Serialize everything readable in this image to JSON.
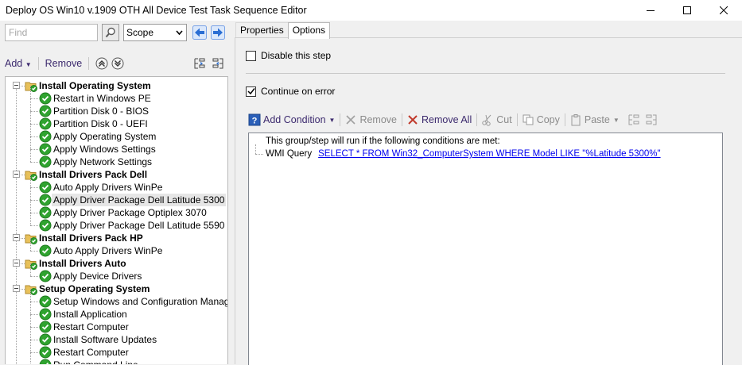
{
  "window": {
    "title": "Deploy OS Win10 v.1909 OTH All Device Test Task Sequence Editor",
    "controls": [
      "minimize-icon",
      "maximize-icon",
      "close-icon"
    ]
  },
  "left_toolbar": {
    "find_placeholder": "Find",
    "search_icon": "magnifier-icon",
    "scope_value": "Scope",
    "back_icon": "arrow-left-icon",
    "forward_icon": "arrow-right-icon",
    "add_label": "Add",
    "remove_label": "Remove",
    "move_up_icon": "move-up-icon",
    "move_down_icon": "move-down-icon",
    "group_icons": [
      "indent-icon",
      "outdent-icon"
    ]
  },
  "tree": [
    {
      "label": "Install Operating System",
      "type": "group"
    },
    {
      "label": "Restart in Windows PE",
      "type": "step"
    },
    {
      "label": "Partition Disk 0 - BIOS",
      "type": "step"
    },
    {
      "label": "Partition Disk 0 - UEFI",
      "type": "step"
    },
    {
      "label": "Apply Operating System",
      "type": "step"
    },
    {
      "label": "Apply Windows Settings",
      "type": "step"
    },
    {
      "label": "Apply Network Settings",
      "type": "step"
    },
    {
      "label": "Install Drivers Pack Dell",
      "type": "group"
    },
    {
      "label": "Auto Apply Drivers WinPe",
      "type": "step"
    },
    {
      "label": "Apply Driver Package Dell Latitude 5300",
      "type": "step",
      "selected": true
    },
    {
      "label": "Apply Driver Package Optiplex 3070",
      "type": "step"
    },
    {
      "label": "Apply Driver Package Dell Latitude 5590",
      "type": "step"
    },
    {
      "label": "Install Drivers Pack HP",
      "type": "group"
    },
    {
      "label": "Auto Apply Drivers WinPe",
      "type": "step"
    },
    {
      "label": "Install Drivers Auto",
      "type": "group"
    },
    {
      "label": "Apply Device Drivers",
      "type": "step"
    },
    {
      "label": "Setup Operating System",
      "type": "group"
    },
    {
      "label": "Setup Windows and Configuration Manager",
      "type": "step"
    },
    {
      "label": "Install Application",
      "type": "step"
    },
    {
      "label": "Restart Computer",
      "type": "step"
    },
    {
      "label": "Install Software Updates",
      "type": "step"
    },
    {
      "label": "Restart Computer",
      "type": "step"
    },
    {
      "label": "Run Command Line",
      "type": "step"
    }
  ],
  "tabs": [
    {
      "label": "Properties",
      "active": false
    },
    {
      "label": "Options",
      "active": true
    }
  ],
  "options": {
    "disable_step": {
      "label": "Disable this step",
      "checked": false
    },
    "continue_on_error": {
      "label": "Continue on error",
      "checked": true
    }
  },
  "condition_toolbar": {
    "add_condition": "Add Condition",
    "remove": "Remove",
    "remove_all": "Remove All",
    "cut": "Cut",
    "copy": "Copy",
    "paste": "Paste"
  },
  "conditions": {
    "intro": "This group/step will run if the following conditions are met:",
    "items": [
      {
        "type": "WMI Query",
        "value": "SELECT * FROM Win32_ComputerSystem WHERE Model LIKE \"%Latitude 5300%\""
      }
    ]
  },
  "colors": {
    "step_check": "#2fa32f",
    "folder": "#e8c15a",
    "link": "#0000ee",
    "remove_all_x": "#c0392b",
    "nav_arrow": "#2b6ed3"
  }
}
